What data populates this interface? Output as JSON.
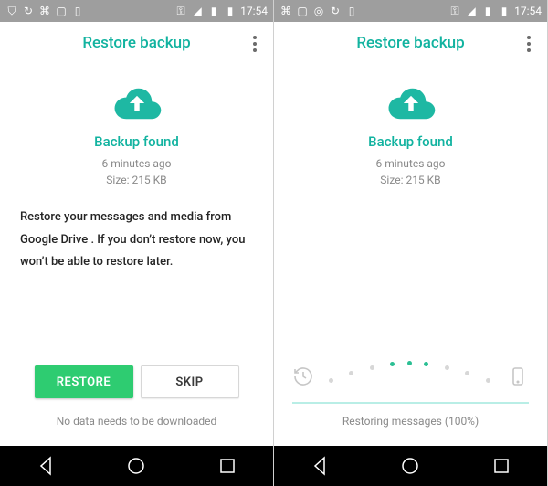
{
  "status": {
    "time": "17:54"
  },
  "app": {
    "title": "Restore backup"
  },
  "backup": {
    "found_label": "Backup found",
    "time_ago": "6 minutes ago",
    "size_line": "Size: 215 KB"
  },
  "left": {
    "description": "Restore your messages and media from Google Drive . If you don’t restore now, you won’t be able to restore later.",
    "restore_label": "RESTORE",
    "skip_label": "SKIP",
    "footer": "No data needs to be downloaded"
  },
  "right": {
    "status_text": "Restoring messages (100%)"
  }
}
